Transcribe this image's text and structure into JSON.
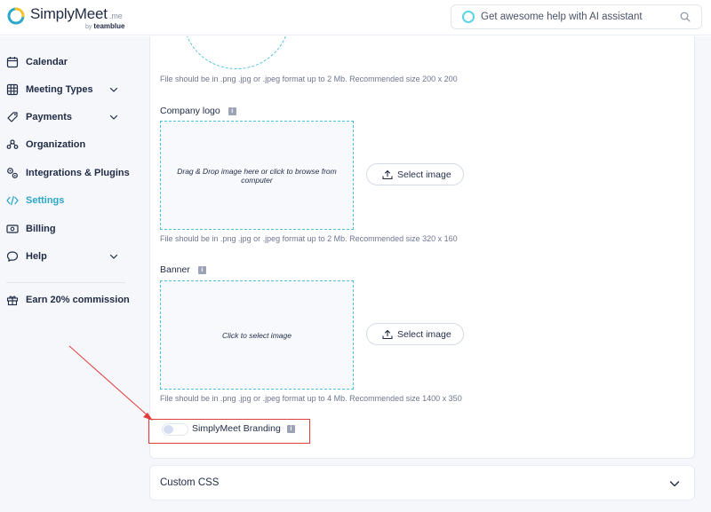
{
  "header": {
    "brand_name": "SimplyMeet",
    "brand_suffix": ".me",
    "brand_by": "by",
    "brand_parent": "teamblue",
    "ai_search_placeholder": "Get awesome help with AI assistant"
  },
  "sidebar": {
    "items": [
      {
        "label": "Calendar",
        "icon": "calendar-icon"
      },
      {
        "label": "Meeting Types",
        "icon": "grid-icon",
        "expandable": true
      },
      {
        "label": "Payments",
        "icon": "tag-icon",
        "expandable": true
      },
      {
        "label": "Organization",
        "icon": "people-icon"
      },
      {
        "label": "Integrations & Plugins",
        "icon": "gear-link-icon"
      },
      {
        "label": "Settings",
        "icon": "code-icon",
        "active": true
      },
      {
        "label": "Billing",
        "icon": "billing-icon"
      },
      {
        "label": "Help",
        "icon": "chat-icon",
        "expandable": true
      }
    ],
    "earn_label": "Earn 20% commission"
  },
  "main": {
    "avatar_hint": "File should be in .png .jpg or .jpeg format up to 2 Mb. Recommended size 200 x 200",
    "company_logo": {
      "label": "Company logo",
      "dropzone_text": "Drag & Drop image here or click to browse from computer",
      "button_label": "Select image",
      "hint": "File should be in .png .jpg or .jpeg format up to 2 Mb. Recommended size 320 x 160"
    },
    "banner": {
      "label": "Banner",
      "dropzone_text": "Click to select image",
      "button_label": "Select image",
      "hint": "File should be in .png .jpg or .jpeg format up to 4 Mb. Recommended size 1400 x 350"
    },
    "branding_toggle": {
      "label": "SimplyMeet Branding",
      "enabled": false
    },
    "info_badge": "i",
    "custom_css_label": "Custom CSS"
  },
  "colors": {
    "accent": "#2aa7c9",
    "annotation": "#e23b3b",
    "dashed_border": "#4fc1dc"
  }
}
